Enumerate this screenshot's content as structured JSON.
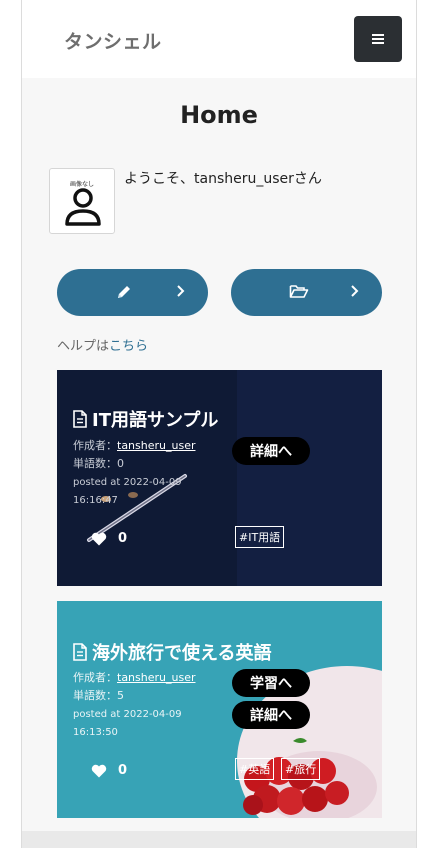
{
  "header": {
    "brand": "タンシェル",
    "menu_icon": "hamburger-icon"
  },
  "page": {
    "title": "Home"
  },
  "user": {
    "avatar_text": "画像なし",
    "welcome": "ようこそ、tansheru_userさん"
  },
  "actions": [
    {
      "icon": "pencil-icon"
    },
    {
      "icon": "folder-open-icon"
    }
  ],
  "help": {
    "prefix": "ヘルプは",
    "link": "こちら"
  },
  "cards": [
    {
      "title": "IT用語サンプル",
      "author_label": "作成者：",
      "author": "tansheru_user",
      "count_label": "単語数：",
      "count": "0",
      "posted": "posted at 2022-04-09",
      "time": "16:16:47",
      "detail_button": "詳細へ",
      "tags": [
        "#IT用語"
      ],
      "likes": "0"
    },
    {
      "title": "海外旅行で使える英語",
      "author_label": "作成者：",
      "author": "tansheru_user",
      "count_label": "単語数：",
      "count": "5",
      "posted": "posted at 2022-04-09",
      "time": "16:13:50",
      "study_button": "学習へ",
      "detail_button": "詳細へ",
      "tags": [
        "#英語",
        "#旅行"
      ],
      "likes": "0"
    }
  ],
  "colors": {
    "accent": "#2e6f92",
    "menu_bg": "#2b2f33",
    "card1_bg": "#0f1a35",
    "card2_bg": "#37a3b6"
  }
}
